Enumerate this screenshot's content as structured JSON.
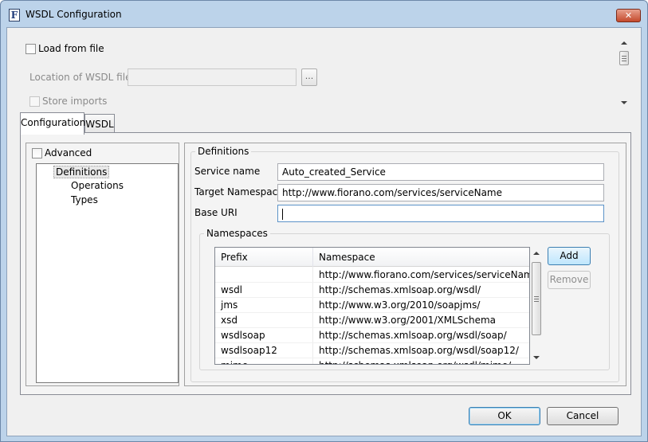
{
  "window": {
    "title": "WSDL Configuration",
    "app_icon_glyph": "F",
    "close_glyph": "✕"
  },
  "top": {
    "load_from_file_label": "Load from file",
    "location_label": "Location of WSDL file",
    "location_value": "",
    "browse_label": "...",
    "store_imports_label": "Store imports"
  },
  "tabs": [
    {
      "label": "Configuration",
      "active": true
    },
    {
      "label": "WSDL",
      "active": false
    }
  ],
  "left": {
    "advanced_label": "Advanced",
    "tree": [
      "Definitions",
      "Operations",
      "Types"
    ]
  },
  "definitions": {
    "group_title": "Definitions",
    "service_name_label": "Service name",
    "service_name_value": "Auto_created_Service",
    "target_ns_label": "Target Namespace",
    "target_ns_value": "http://www.fiorano.com/services/serviceName",
    "base_uri_label": "Base URI",
    "base_uri_value": ""
  },
  "namespaces": {
    "group_title": "Namespaces",
    "columns": [
      "Prefix",
      "Namespace"
    ],
    "rows": [
      [
        "",
        "http://www.fiorano.com/services/serviceName"
      ],
      [
        "wsdl",
        "http://schemas.xmlsoap.org/wsdl/"
      ],
      [
        "jms",
        "http://www.w3.org/2010/soapjms/"
      ],
      [
        "xsd",
        "http://www.w3.org/2001/XMLSchema"
      ],
      [
        "wsdlsoap",
        "http://schemas.xmlsoap.org/wsdl/soap/"
      ],
      [
        "wsdlsoap12",
        "http://schemas.xmlsoap.org/wsdl/soap12/"
      ],
      [
        "mime",
        "http://schemas.xmlsoap.org/wsdl/mime/"
      ]
    ],
    "add_label": "Add",
    "remove_label": "Remove"
  },
  "footer": {
    "ok_label": "OK",
    "cancel_label": "Cancel"
  },
  "colors": {
    "title_bar": "#bcd3ea",
    "close_button": "#c44a2c",
    "selection_blue": "#bee6fd"
  }
}
